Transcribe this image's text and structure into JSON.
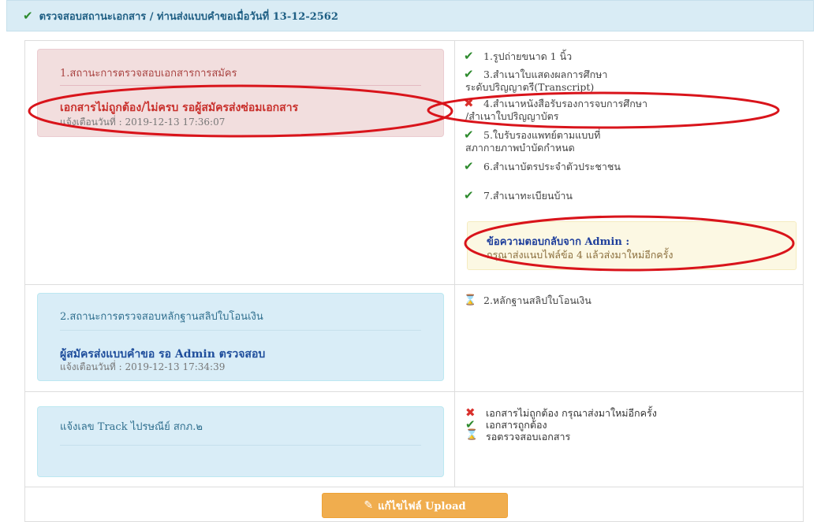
{
  "header": {
    "title": "ตรวจสอบสถานะเอกสาร / ท่านส่งแบบคำขอเมื่อวันที่ 13-12-2562"
  },
  "sections": [
    {
      "heading": "1.สถานะการตรวจสอบเอกสารการสมัคร",
      "status": "เอกสารไม่ถูกต้อง/ไม่ครบ รอผู้สมัครส่งซ่อมเอกสาร",
      "notice": "แจ้งเตือนวันที่ : 2019-12-13 17:36:07"
    },
    {
      "heading": "2.สถานะการตรวจสอบหลักฐานสลิปใบโอนเงิน",
      "status": "ผู้สมัครส่งแบบคำขอ รอ Admin ตรวจสอบ",
      "notice": "แจ้งเตือนวันที่ : 2019-12-13 17:34:39"
    },
    {
      "heading": "แจ้งเลข Track ไปรษณีย์ สกภ.๒"
    }
  ],
  "documents": [
    {
      "state": "ok",
      "line1": "1.รูปถ่ายขนาด 1 นิ้ว",
      "line2": ""
    },
    {
      "state": "ok",
      "line1": "3.สำเนาใบแสดงผลการศึกษา",
      "line2": "ระดับปริญญาตรี(Transcript)"
    },
    {
      "state": "error",
      "line1": "4.สำเนาหนังสือรับรองการจบการศึกษา",
      "line2": "/สำเนาใบปริญญาบัตร"
    },
    {
      "state": "ok",
      "line1": "5.ใบรับรองแพทย์ตามแบบที่",
      "line2": "สภากายภาพบำบัดกำหนด"
    },
    {
      "state": "ok",
      "line1": "6.สำเนาบัตรประจำตัวประชาชน",
      "line2": ""
    },
    {
      "state": "ok",
      "line1": "7.สำเนาทะเบียนบ้าน",
      "line2": ""
    }
  ],
  "admin_message": {
    "title": "ข้อความตอบกลับจาก Admin :",
    "body": "กรุณาส่งแนบไฟล์ข้อ 4 แล้วส่งมาใหม่อีกครั้ง"
  },
  "payment_item": {
    "state": "pending",
    "label": "2.หลักฐานสลิปใบโอนเงิน"
  },
  "legend": [
    {
      "state": "error",
      "label": "เอกสารไม่ถูกต้อง กรุณาส่งมาใหม่อีกครั้ง"
    },
    {
      "state": "ok",
      "label": "เอกสารถูกต้อง"
    },
    {
      "state": "pending",
      "label": "รอตรวจสอบเอกสาร"
    }
  ],
  "edit_button": {
    "label": "แก้ไขไฟล์ Upload",
    "icon": "edit-icon"
  },
  "colors": {
    "ok": "#2e8b2e",
    "error": "#d9302c",
    "pending": "#e3a72f",
    "button": "#f0ad4e",
    "annotation": "#d9141b"
  }
}
